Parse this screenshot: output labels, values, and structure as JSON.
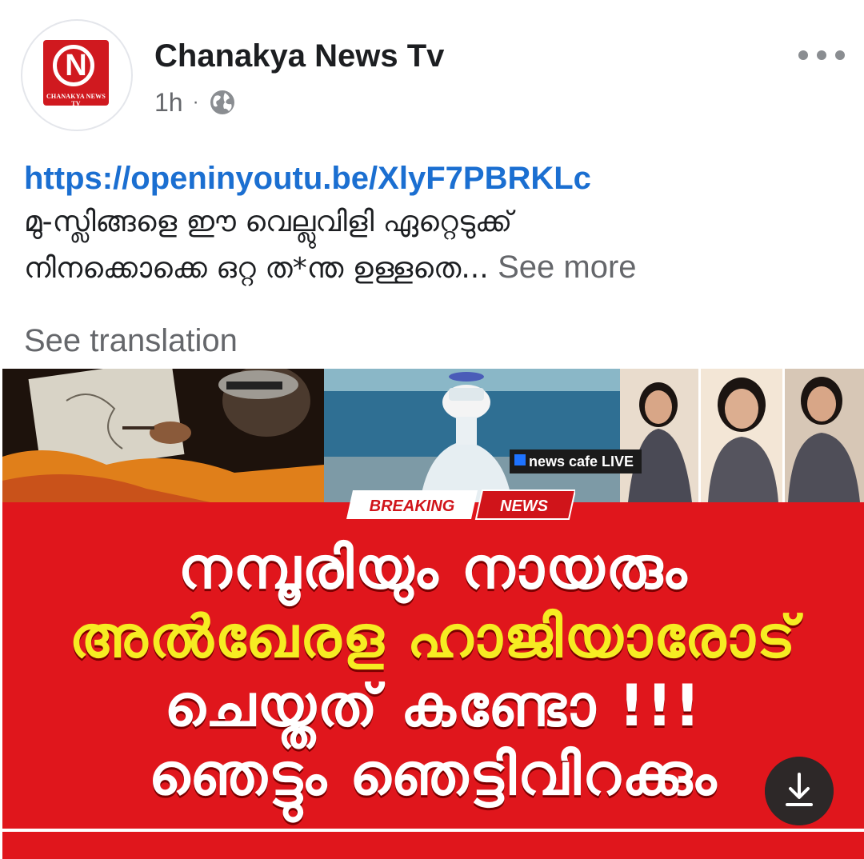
{
  "post": {
    "page_name": "Chanakya News Tv",
    "timestamp": "1h",
    "separator": "·",
    "avatar_caption": "CHANAKYA NEWS TV",
    "avatar_letter": "N",
    "privacy_icon": "globe-icon",
    "more_icon": "more-horizontal-icon"
  },
  "content": {
    "link": "https://openinyoutu.be/XlyF7PBRKLc",
    "line1": "മു-സ്ലിങ്ങളെ ഈ വെല്ലുവിളി ഏറ്റെടുക്ക്",
    "line2": "നിനക്കൊക്കെ ഒറ്റ ത*ന്ത ഉള്ളതെ...",
    "see_more": "See more",
    "see_translation": "See translation"
  },
  "thumbnail": {
    "live_tag": "news cafe LIVE",
    "breaking_word": "BREAKING",
    "news_word": "NEWS",
    "headline_1": "നമ്പൂരിയും നായരും",
    "headline_2": "അൽഖേരള ഹാജിയാരോട്",
    "headline_3": "ചെയ്തത് കണ്ടോ !!!",
    "headline_4": "ഞെട്ടും ഞെട്ടിവിറക്കും",
    "download_icon": "download-icon",
    "colors": {
      "background_red": "#e0161c",
      "headline_white": "#ffffff",
      "headline_yellow": "#f6ec22",
      "link_blue": "#1b6fd1"
    }
  }
}
